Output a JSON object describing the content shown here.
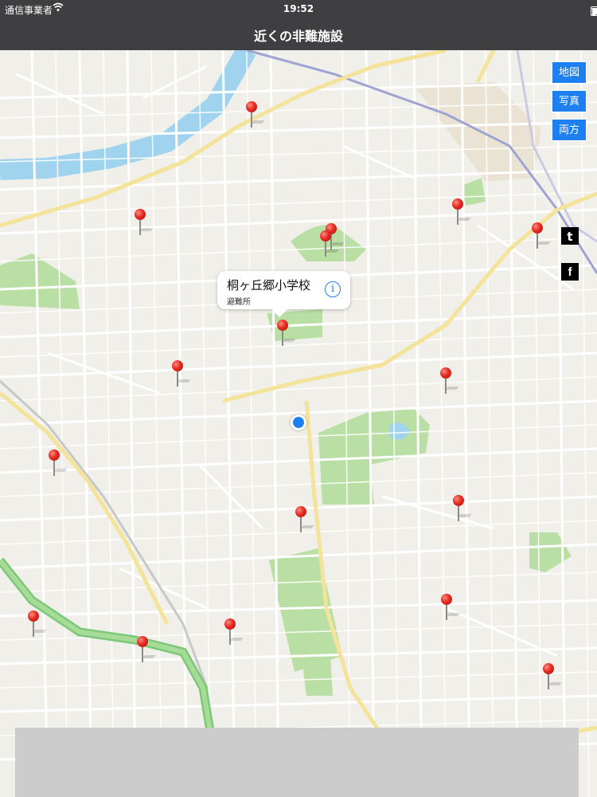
{
  "status_bar": {
    "carrier": "通信事業者",
    "time": "19:52",
    "battery": "100%",
    "battery_level": 1.0
  },
  "nav_bar": {
    "title": "近くの非難施設"
  },
  "map_controls": {
    "map_label": "地図",
    "photo_label": "写真",
    "both_label": "両方"
  },
  "callout": {
    "title": "桐ヶ丘郷小学校",
    "subtitle": "避難所",
    "info_icon": "info-icon"
  },
  "social": {
    "twitter": "t",
    "facebook": "f"
  },
  "colors": {
    "accent": "#1e7ff0",
    "pin": "#e42b22",
    "river": "#9fd3ee",
    "park": "#b9dfa4",
    "highway": "#7bc87a",
    "header": "#3f3f41"
  }
}
